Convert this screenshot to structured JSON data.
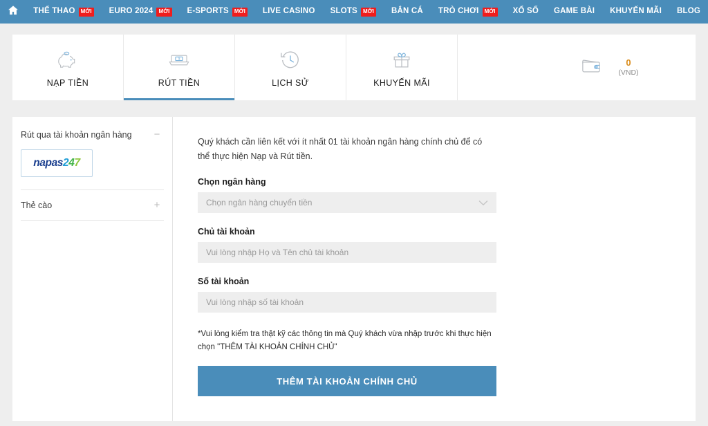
{
  "nav": {
    "home_icon": "home-icon",
    "items": [
      {
        "label": "THỂ THAO",
        "badge": "MỚI"
      },
      {
        "label": "EURO 2024",
        "badge": "MỚI"
      },
      {
        "label": "E-SPORTS",
        "badge": "MỚI"
      },
      {
        "label": "LIVE CASINO",
        "badge": ""
      },
      {
        "label": "SLOTS",
        "badge": "MỚI"
      },
      {
        "label": "BẮN CÁ",
        "badge": ""
      },
      {
        "label": "TRÒ CHƠI",
        "badge": "MỚI"
      },
      {
        "label": "XỔ SỐ",
        "badge": ""
      },
      {
        "label": "GAME BÀI",
        "badge": ""
      },
      {
        "label": "KHUYẾN MÃI",
        "badge": ""
      },
      {
        "label": "BLOG",
        "badge": ""
      }
    ]
  },
  "tabs": [
    {
      "label": "NẠP TIỀN",
      "icon": "piggy-bank-icon",
      "active": false
    },
    {
      "label": "RÚT TIỀN",
      "icon": "atm-cash-icon",
      "active": true
    },
    {
      "label": "LỊCH SỬ",
      "icon": "history-clock-icon",
      "active": false
    },
    {
      "label": "KHUYẾN MÃI",
      "icon": "gift-icon",
      "active": false
    }
  ],
  "wallet": {
    "icon": "wallet-icon",
    "balance": "0",
    "currency": "(VND)"
  },
  "sidebar": {
    "sections": [
      {
        "title": "Rút qua tài khoản ngân hàng",
        "toggle": "−",
        "expanded": true
      },
      {
        "title": "Thẻ cào",
        "toggle": "+",
        "expanded": false
      }
    ],
    "napas_logo": {
      "part1": "napas",
      "part2": "2",
      "part3": "4",
      "part4": "7"
    }
  },
  "form": {
    "intro": "Quý khách cần liên kết với ít nhất 01 tài khoản ngân hàng chính chủ để có thể thực hiện Nạp và Rút tiền.",
    "bank_label": "Chọn ngân hàng",
    "bank_placeholder": "Chọn ngân hàng chuyển tiền",
    "holder_label": "Chủ tài khoản",
    "holder_placeholder": "Vui lòng nhập Họ và Tên chủ tài khoản",
    "account_label": "Số tài khoản",
    "account_placeholder": "Vui lòng nhập số tài khoản",
    "note": "*Vui lòng kiểm tra thật kỹ các thông tin mà Quý khách vừa nhập trước khi thực hiện chọn \"THÊM TÀI KHOẢN CHÍNH CHỦ\"",
    "submit_label": "THÊM TÀI KHOẢN CHÍNH CHỦ"
  },
  "colors": {
    "brand_blue": "#4a8dba",
    "badge_red": "#f01d1d",
    "balance_gold": "#d98b19",
    "page_bg": "#eeeeee"
  }
}
